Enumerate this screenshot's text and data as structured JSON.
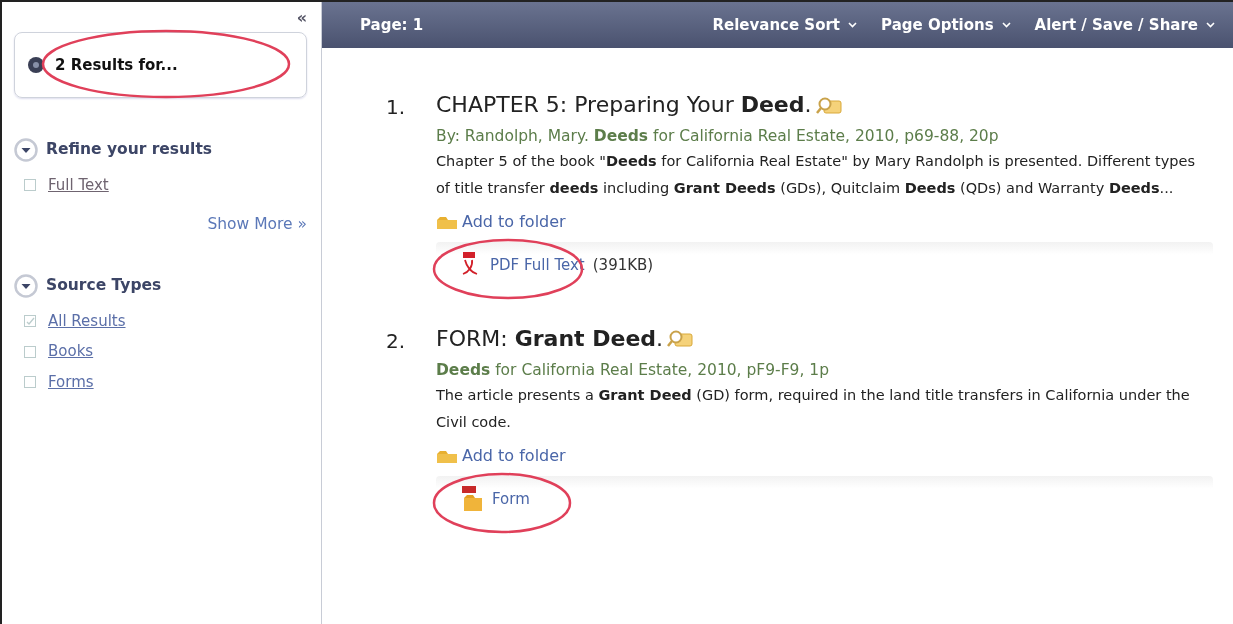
{
  "sidebar": {
    "collapse_glyph": "«",
    "results_box": {
      "text": "2 Results for...",
      "circled": true
    },
    "sections": [
      {
        "title": "Refine your results",
        "expanded": true,
        "items": [
          {
            "label": "Full Text",
            "checked": false
          }
        ],
        "link": "Show More »"
      },
      {
        "title": "Source Types",
        "expanded": true,
        "items": [
          {
            "label": "All Results",
            "checked": true
          },
          {
            "label": "Books",
            "checked": false
          },
          {
            "label": "Forms",
            "checked": false
          }
        ]
      }
    ]
  },
  "toolbar": {
    "page": "Page: 1",
    "menus": [
      "Relevance Sort",
      "Page Options",
      "Alert / Save / Share"
    ]
  },
  "results": [
    {
      "number": "1.",
      "title": "CHAPTER 5: Preparing Your **Deed**.",
      "source": "By: Randolph, Mary. **Deeds** for California Real Estate, 2010, p69-88, 20p",
      "abstract": "Chapter 5 of the book \"**Deeds** for California Real Estate\" by Mary Randolph is presented. Different types of title transfer **deeds** including **Grant Deeds** (GDs), Quitclaim **Deeds** (QDs) and Warranty **Deeds**...",
      "folder": "Add to folder",
      "link": {
        "kind": "pdf",
        "label": "PDF Full Text",
        "size": "(391KB)",
        "circled": true
      }
    },
    {
      "number": "2.",
      "title": "FORM: **Grant Deed**.",
      "source": "**Deeds** for California Real Estate, 2010, pF9-F9, 1p",
      "abstract": "The article presents a **Grant Deed** (GD) form, required in the land title transfers in California under the Civil code.",
      "folder": "Add to folder",
      "link": {
        "kind": "form",
        "label": "Form",
        "circled": true
      }
    }
  ]
}
